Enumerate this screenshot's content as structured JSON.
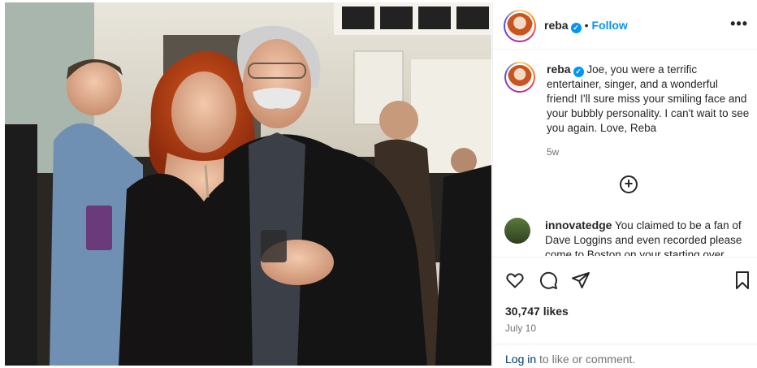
{
  "post": {
    "username": "reba",
    "verified_icon": "verified-badge-icon",
    "separator": "•",
    "follow_label": "Follow",
    "more_icon": "more-options-icon"
  },
  "caption": {
    "username": "reba",
    "text": "Joe, you were a terrific entertainer, singer, and a wonderful friend! I'll sure miss your smiling face and your bubbly personality. I can't wait to see you again. Love, Reba",
    "time": "5w"
  },
  "load_more_icon": "plus-circle-icon",
  "comments": [
    {
      "username": "innovatedge",
      "text": "You claimed to be a fan of Dave Loggins and even recorded please come to Boston on your starting over"
    }
  ],
  "actions": {
    "like_icon": "heart-icon",
    "comment_icon": "comment-icon",
    "share_icon": "share-icon",
    "save_icon": "bookmark-icon",
    "likes": "30,747 likes",
    "date": "July 10"
  },
  "login": {
    "link": "Log in",
    "suffix": " to like or comment."
  },
  "colors": {
    "accent": "#0095f6",
    "text": "#262626",
    "muted": "#737373"
  }
}
